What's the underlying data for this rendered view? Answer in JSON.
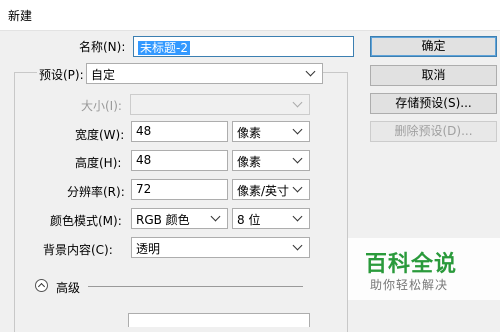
{
  "window": {
    "title": "新建"
  },
  "form": {
    "name_label": "名称(N):",
    "name_value": "未标题-2",
    "preset_label": "预设(P):",
    "preset_value": "自定",
    "size_label": "大小(I):",
    "size_value": "",
    "width_label": "宽度(W):",
    "width_value": "48",
    "width_unit": "像素",
    "height_label": "高度(H):",
    "height_value": "48",
    "height_unit": "像素",
    "resolution_label": "分辨率(R):",
    "resolution_value": "72",
    "resolution_unit": "像素/英寸",
    "color_mode_label": "颜色模式(M):",
    "color_mode_value": "RGB 颜色",
    "bit_depth_value": "8 位",
    "background_label": "背景内容(C):",
    "background_value": "透明",
    "advanced_label": "高级"
  },
  "buttons": {
    "ok": "确定",
    "cancel": "取消",
    "save_preset": "存储预设(S)...",
    "delete_preset": "删除预设(D)..."
  },
  "watermark": {
    "title": "百科全说",
    "subtitle": "助你轻松解决"
  },
  "colors": {
    "selection": "#3399ff",
    "focus_border": "#3c7fb1",
    "watermark_green": "#2a9a3b"
  }
}
